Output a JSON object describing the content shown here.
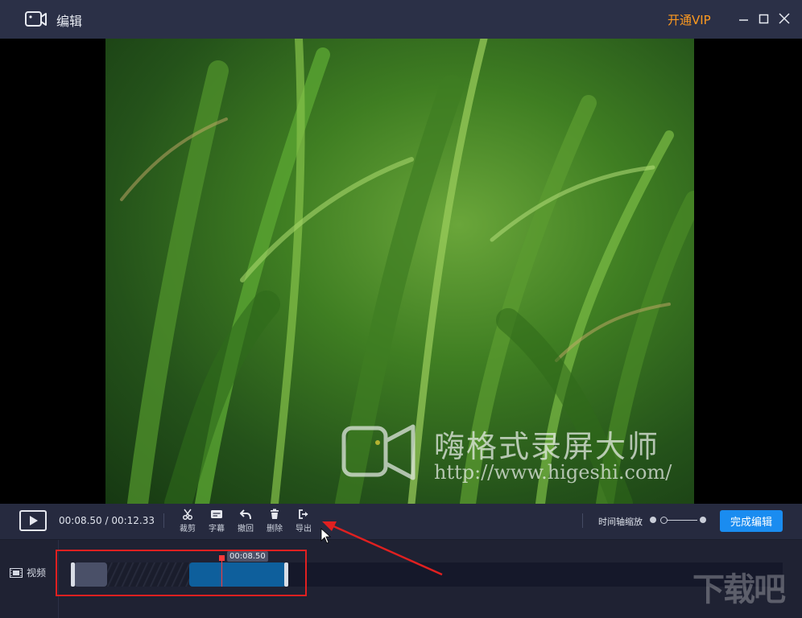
{
  "window": {
    "title": "编辑",
    "vip_label": "开通VIP",
    "icons": [
      "camera-icon",
      "minimize-icon",
      "maximize-icon",
      "close-icon"
    ]
  },
  "preview": {
    "watermark_cn": "嗨格式录屏大师",
    "watermark_url": "http://www.higeshi.com/"
  },
  "toolbar": {
    "time_display": "00:08.50 / 00:12.33",
    "tools": [
      {
        "label": "裁剪",
        "icon": "scissors-icon"
      },
      {
        "label": "字幕",
        "icon": "subtitle-icon"
      },
      {
        "label": "撤回",
        "icon": "undo-icon"
      },
      {
        "label": "删除",
        "icon": "trash-icon"
      },
      {
        "label": "导出",
        "icon": "export-icon"
      }
    ],
    "zoom_label": "时间轴缩放",
    "done_label": "完成编辑"
  },
  "timeline": {
    "track_label": "视频",
    "playhead_time": "00:08.50"
  },
  "corner_watermark": "下载吧",
  "colors": {
    "accent": "#1a8cf0",
    "vip": "#ff9a1f",
    "annotation": "#e02020",
    "playhead": "#ff3a3a"
  }
}
